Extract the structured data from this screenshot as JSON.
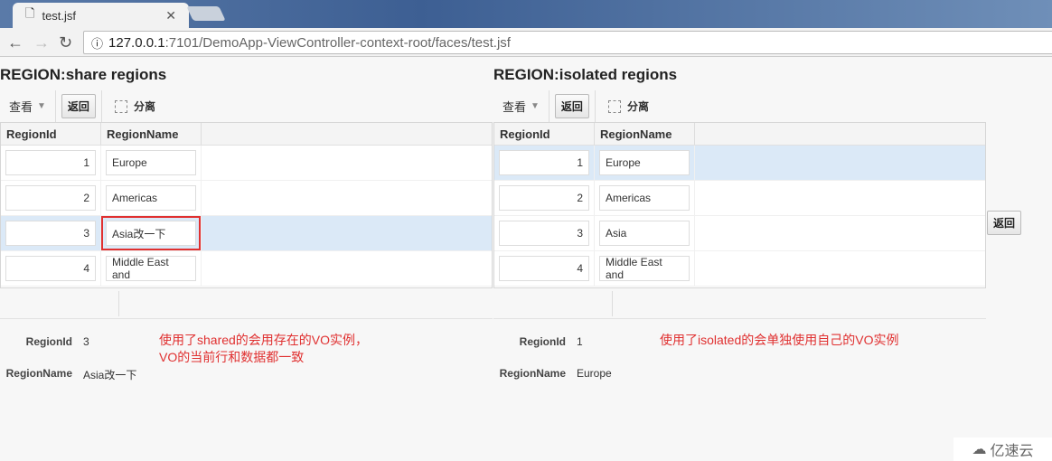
{
  "browser": {
    "tab_title": "test.jsf",
    "url_host": "127.0.0.1",
    "url_path": ":7101/DemoApp-ViewController-context-root/faces/test.jsf"
  },
  "panels": [
    {
      "title": "REGION:share regions",
      "toolbar": {
        "view": "查看",
        "back": "返回",
        "detach": "分离"
      },
      "columns": [
        "RegionId",
        "RegionName"
      ],
      "rows": [
        [
          "1",
          "Europe"
        ],
        [
          "2",
          "Americas"
        ],
        [
          "3",
          "Asia改一下"
        ],
        [
          "4",
          "Middle East and"
        ]
      ],
      "selected_row": 3,
      "form": {
        "id_label": "RegionId",
        "id_value": "3",
        "name_label": "RegionName",
        "name_value": "Asia改一下"
      },
      "note": [
        "使用了shared的会用存在的VO实例，",
        "VO的当前行和数据都一致"
      ]
    },
    {
      "title": "REGION:isolated regions",
      "toolbar": {
        "view": "查看",
        "back": "返回",
        "detach": "分离"
      },
      "columns": [
        "RegionId",
        "RegionName"
      ],
      "rows": [
        [
          "1",
          "Europe"
        ],
        [
          "2",
          "Americas"
        ],
        [
          "3",
          "Asia"
        ],
        [
          "4",
          "Middle East and"
        ]
      ],
      "selected_row": 1,
      "form": {
        "id_label": "RegionId",
        "id_value": "1",
        "name_label": "RegionName",
        "name_value": "Europe"
      },
      "note": [
        "使用了isolated的会单独使用自己的VO实例"
      ]
    }
  ],
  "right_back": "返回",
  "watermark": "亿速云",
  "colors": {
    "annotation": "#e03030",
    "selection": "#dbe9f7"
  }
}
